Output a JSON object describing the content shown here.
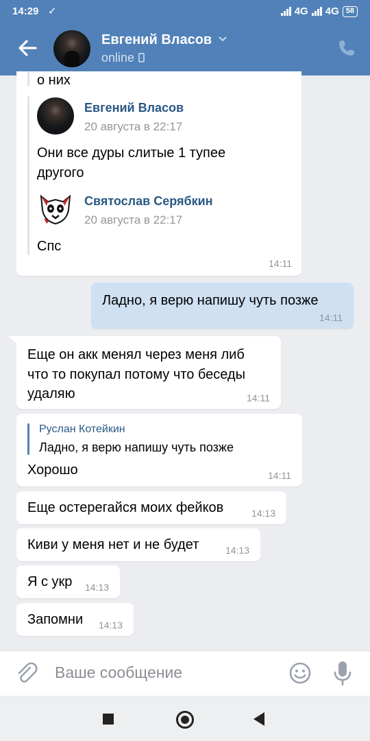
{
  "status_bar": {
    "time": "14:29",
    "check": "✓",
    "net1": "4G",
    "net2": "4G",
    "battery": "58"
  },
  "header": {
    "name": "Евгений Власов",
    "status": "online"
  },
  "messages": [
    {
      "id": "m1",
      "partial_text": "о них",
      "forwards": [
        {
          "author": "Евгений Власов",
          "date": "20 августа в 22:17",
          "text1": "Они все дуры слитые 1 тупее",
          "text2": "другого"
        },
        {
          "author": "Святослав Серябкин",
          "date": "20 августа в 22:17",
          "text": "Спс"
        }
      ],
      "time": "14:11"
    },
    {
      "id": "m2",
      "direction": "out",
      "text": "Ладно, я верю напишу чуть позже",
      "time": "14:11"
    },
    {
      "id": "m3",
      "lines": [
        "Еще он акк менял через меня либ",
        "что то покупал потому что беседы",
        "удаляю"
      ],
      "time": "14:11"
    },
    {
      "id": "m4",
      "reply_author": "Руслан Котейкин",
      "reply_text": "Ладно, я верю напишу чуть позже",
      "text": "Хорошо",
      "time": "14:11"
    },
    {
      "id": "m5",
      "text": "Еще остерегайся моих фейков",
      "time": "14:13"
    },
    {
      "id": "m6",
      "text": "Киви у меня нет и не будет",
      "time": "14:13"
    },
    {
      "id": "m7",
      "text": "Я с укр",
      "time": "14:13"
    },
    {
      "id": "m8",
      "text": "Запомни",
      "time": "14:13"
    }
  ],
  "input": {
    "placeholder": "Ваше сообщение"
  },
  "colors": {
    "header": "#5181b8",
    "outgoing": "#cfe0f3",
    "link": "#2a5885"
  }
}
